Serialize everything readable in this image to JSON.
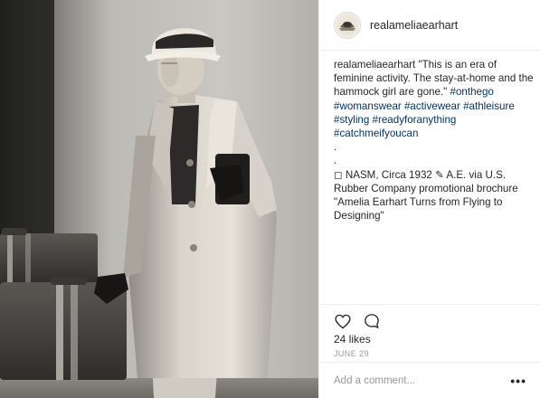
{
  "post": {
    "username": "realameliaearhart",
    "caption_quote": "\"This is an era of feminine activity. The stay-at-home and the hammock girl are gone.\"",
    "hashtags": [
      "#onthego",
      "#womanswear",
      "#activewear",
      "#athleisure",
      "#styling",
      "#readyforanything",
      "#catchmeifyoucan"
    ],
    "dot_lines": [
      ".",
      "."
    ],
    "credit_lines": [
      "◻ NASM, Circa 1932 ✎ A.E. via U.S. Rubber Company promotional brochure \"Amelia Earhart Turns from Flying to Designing\""
    ],
    "likes": "24 likes",
    "date": "JUNE 29"
  },
  "icons": {
    "like": "heart-icon",
    "comment": "comment-bubble-icon",
    "more": "more-options-icon",
    "avatar": "profile-avatar"
  },
  "comment": {
    "placeholder": "Add a comment...",
    "more_label": "•••"
  },
  "colors": {
    "hashtag": "#003569",
    "text": "#262626",
    "muted": "#999999",
    "border": "#efefef"
  }
}
